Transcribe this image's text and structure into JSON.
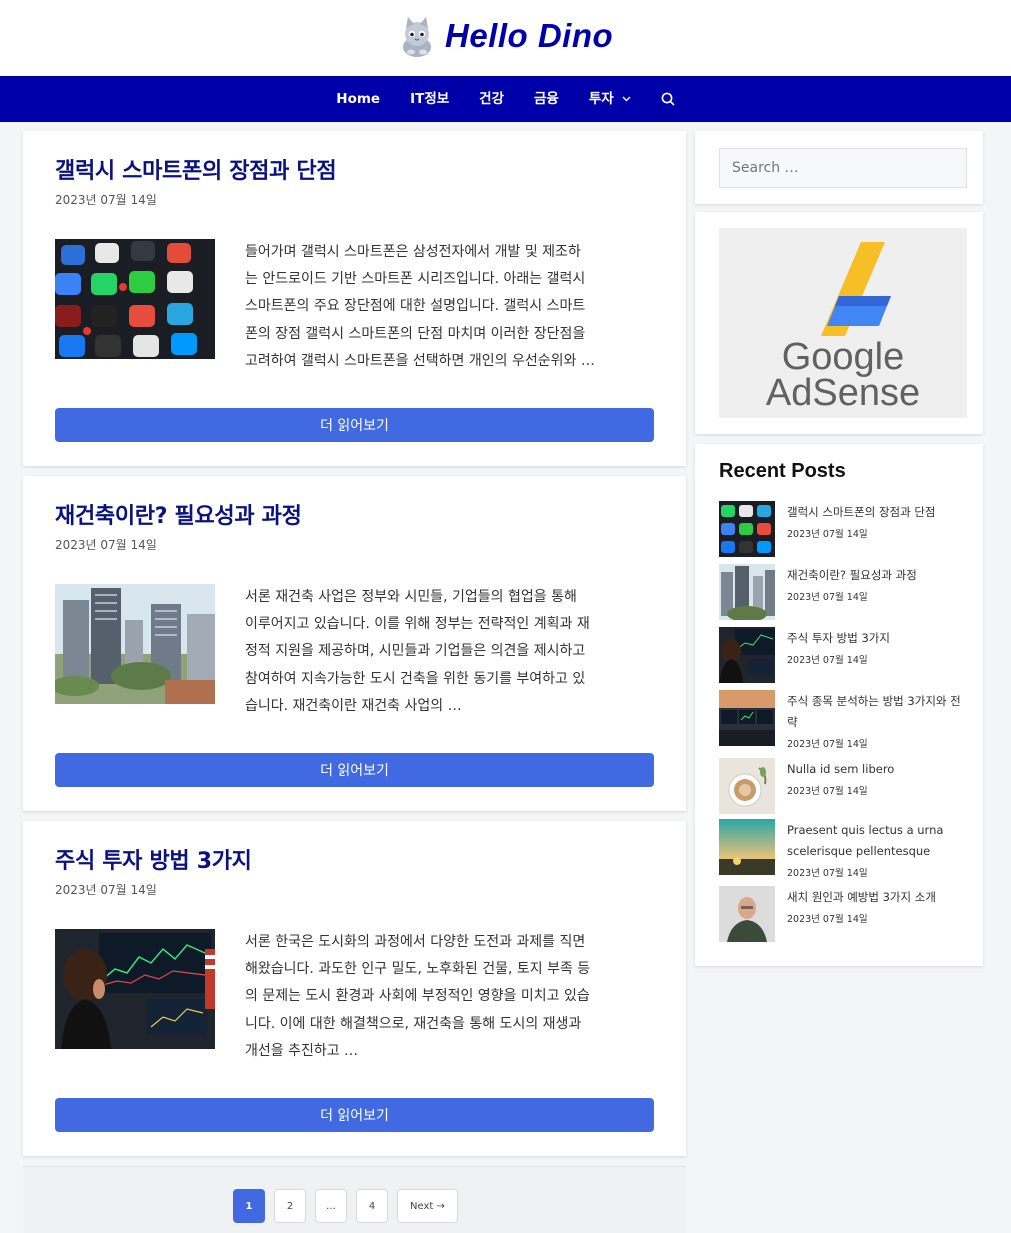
{
  "site": {
    "title": "Hello Dino"
  },
  "nav": {
    "items": [
      {
        "label": "Home"
      },
      {
        "label": "IT정보"
      },
      {
        "label": "건강"
      },
      {
        "label": "금융"
      },
      {
        "label": "투자"
      }
    ],
    "icons": {
      "dropdown": "chevron-down-icon",
      "search": "search-icon"
    }
  },
  "posts": [
    {
      "title": "갤럭시 스마트폰의 장점과 단점",
      "date": "2023년 07월 14일",
      "excerpt_lines": [
        "들어가며 갤럭시 스마트폰은 삼성전자에서 개발 및 제조하",
        "는 안드로이드 기반 스마트폰 시리즈입니다. 아래는 갤럭시",
        "스마트폰의 주요 장단점에 대한 설명입니다. 갤럭시 스마트",
        "폰의 장점 갤럭시 스마트폰의 단점 마치며 이러한 장단점을",
        "고려하여 갤럭시 스마트폰을 선택하면 개인의 우선순위와 …"
      ],
      "read_more": "더 읽어보기"
    },
    {
      "title": "재건축이란? 필요성과 과정",
      "date": "2023년 07월 14일",
      "excerpt_lines": [
        "서론 재건축 사업은 정부와 시민들, 기업들의 협업을 통해",
        "이루어지고 있습니다. 이를 위해 정부는 전략적인 계획과 재",
        "정적 지원을 제공하며, 시민들과 기업들은 의견을 제시하고",
        "참여하여 지속가능한 도시 건축을 위한 동기를 부여하고 있",
        "습니다. 재건축이란 재건축 사업의 …"
      ],
      "read_more": "더 읽어보기"
    },
    {
      "title": "주식 투자 방법 3가지",
      "date": "2023년 07월 14일",
      "excerpt_lines": [
        "서론 한국은 도시화의 과정에서 다양한 도전과 과제를 직면",
        "해왔습니다. 과도한 인구 밀도, 노후화된 건물, 토지 부족 등",
        "의 문제는 도시 환경과 사회에 부정적인 영향을 미치고 있습",
        "니다. 이에 대한 해결책으로, 재건축을 통해 도시의 재생과",
        "개선을 추진하고 …"
      ],
      "read_more": "더 읽어보기"
    }
  ],
  "pagination": {
    "pages": [
      "1",
      "2",
      "…",
      "4"
    ],
    "current": "1",
    "next": "Next →"
  },
  "sidebar": {
    "search_placeholder": "Search …",
    "ad": {
      "line1": "Google",
      "line2": "AdSense"
    },
    "recent_title": "Recent Posts",
    "recent": [
      {
        "title": "갤럭시 스마트폰의 장점과 단점",
        "date": "2023년 07월 14일"
      },
      {
        "title": "재건축이란? 필요성과 과정",
        "date": "2023년 07월 14일"
      },
      {
        "title": "주식 투자 방법 3가지",
        "date": "2023년 07월 14일"
      },
      {
        "title": "주식 종목 분석하는 방법 3가지와 전략",
        "date": "2023년 07월 14일"
      },
      {
        "title": "Nulla id sem libero",
        "date": "2023년 07월 14일"
      },
      {
        "title": "Praesent quis lectus a urna scelerisque pellentesque",
        "date": "2023년 07월 14일"
      },
      {
        "title": "새치 원인과 예방법 3가지 소개",
        "date": "2023년 07월 14일"
      }
    ]
  },
  "colors": {
    "brand": "#0000a8",
    "accent": "#4169e1",
    "title": "#0a1280"
  }
}
